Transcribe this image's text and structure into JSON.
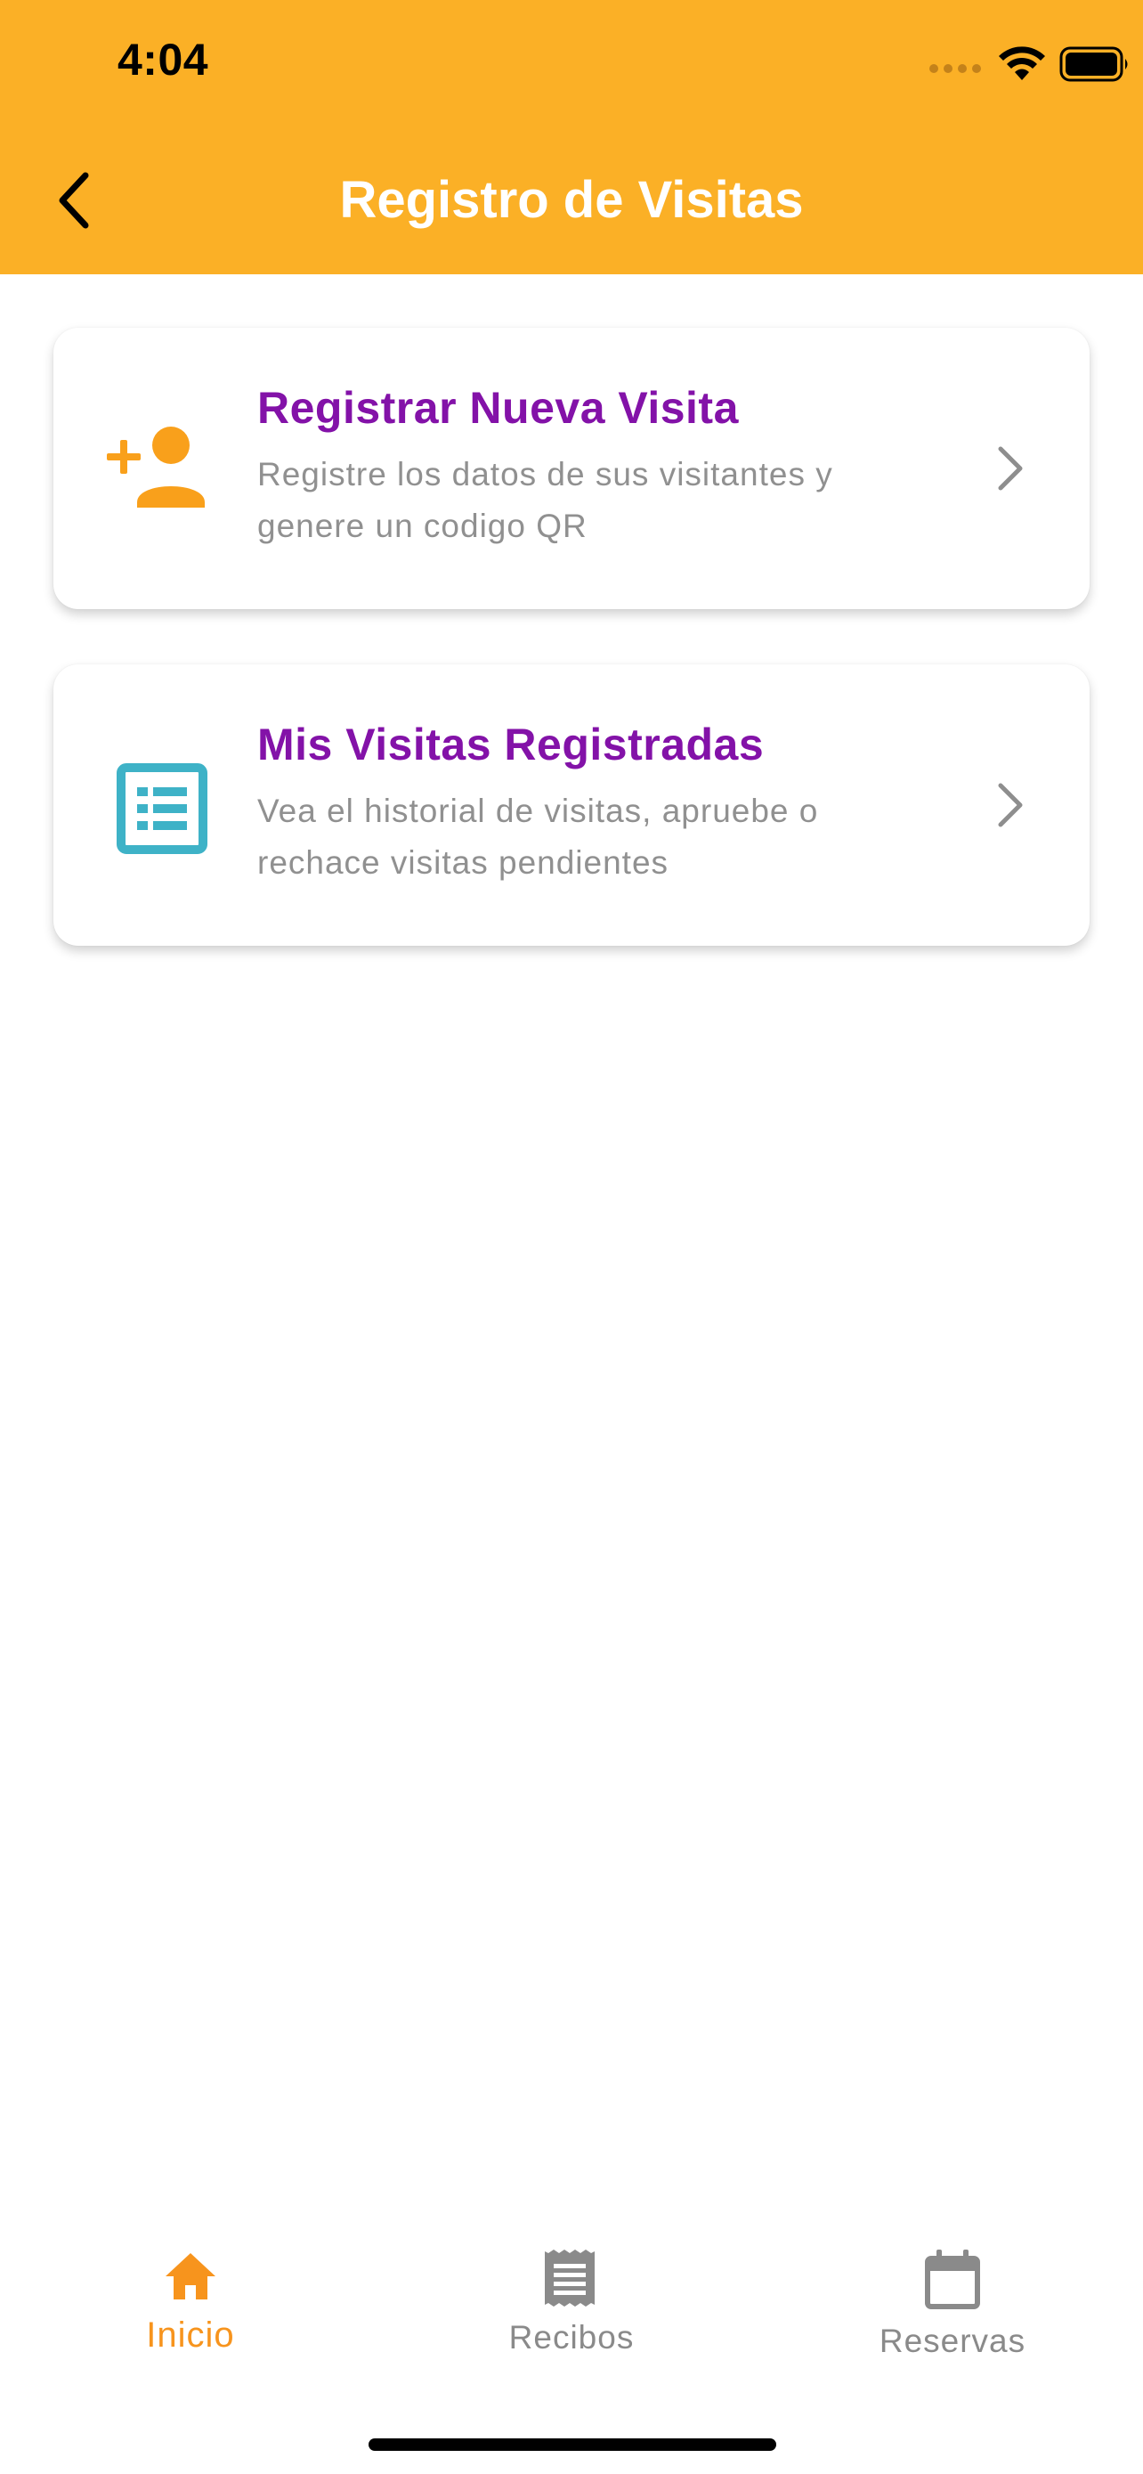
{
  "status_bar": {
    "time": "4:04"
  },
  "header": {
    "title": "Registro de Visitas",
    "background": "#FBB026",
    "back_icon": "chevron-left-icon"
  },
  "cards": [
    {
      "title": "Registrar Nueva Visita",
      "description": "Registre los datos de sus visitantes y genere un codigo QR",
      "icon": "person-add-icon",
      "icon_color": "#F9A01B"
    },
    {
      "title": "Mis Visitas Registradas",
      "description": "Vea el historial de visitas, apruebe o rechace visitas pendientes",
      "icon": "list-icon",
      "icon_color": "#3EB2C7"
    }
  ],
  "tabs": [
    {
      "label": "Inicio",
      "icon": "home-icon",
      "active": true
    },
    {
      "label": "Recibos",
      "icon": "receipt-icon",
      "active": false
    },
    {
      "label": "Reservas",
      "icon": "calendar-icon",
      "active": false
    }
  ],
  "colors": {
    "accent": "#FBB026",
    "title_purple": "#8312A8",
    "tab_active": "#F7941D",
    "tab_inactive": "#8A8A8A"
  }
}
